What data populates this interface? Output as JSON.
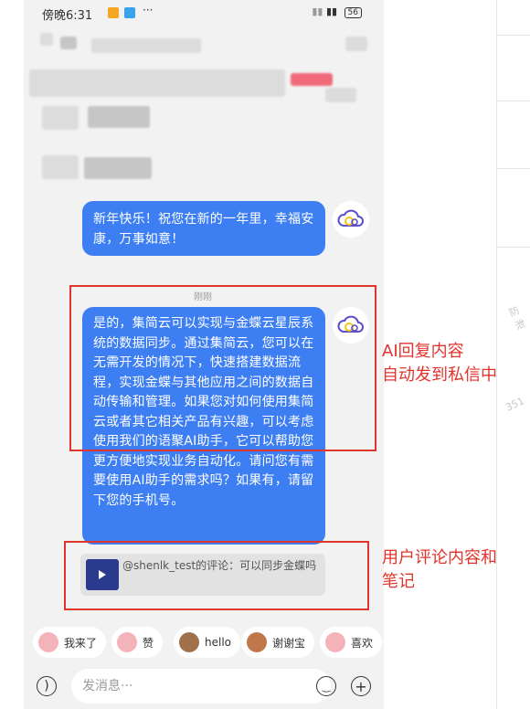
{
  "status_bar": {
    "time": "傍晚6:31",
    "battery": "56"
  },
  "messages": [
    {
      "text": "新年快乐！祝您在新的一年里，幸福安康，万事如意！"
    },
    {
      "time": "刚刚",
      "text": "是的，集简云可以实现与金蝶云星辰系统的数据同步。通过集简云，您可以在无需开发的情况下，快速搭建数据流程，实现金蝶与其他应用之间的数据自动传输和管理。如果您对如何使用集简云或者其它相关产品有兴趣，可以考虑使用我们的语聚AI助手，它可以帮助您更方便地实现业务自动化。请问您有需要使用AI助手的需求吗？如果有，请留下您的手机号。"
    }
  ],
  "quote": {
    "text": "@shenlk_test的评论：可以同步金蝶吗"
  },
  "annotations": {
    "ai_reply": "AI回复内容\n自动发到私信中",
    "user_comment": "用户评论内容和\n笔记"
  },
  "quick_replies": [
    {
      "label": "我来了",
      "icon": "pig-emoji-icon"
    },
    {
      "label": "赞",
      "icon": "pig-thumbs-emoji-icon"
    },
    {
      "label": "hello",
      "icon": "monkey-emoji-icon"
    },
    {
      "label": "谢谢宝",
      "icon": "bear-emoji-icon"
    },
    {
      "label": "喜欢",
      "icon": "pig-heart-emoji-icon"
    }
  ],
  "input": {
    "placeholder": "发消息···"
  },
  "side_watermarks": [
    "防泄",
    "351"
  ],
  "colors": {
    "bubble": "#3d7ff3",
    "annotation": "#e0342c",
    "background": "#f2f2f2"
  }
}
